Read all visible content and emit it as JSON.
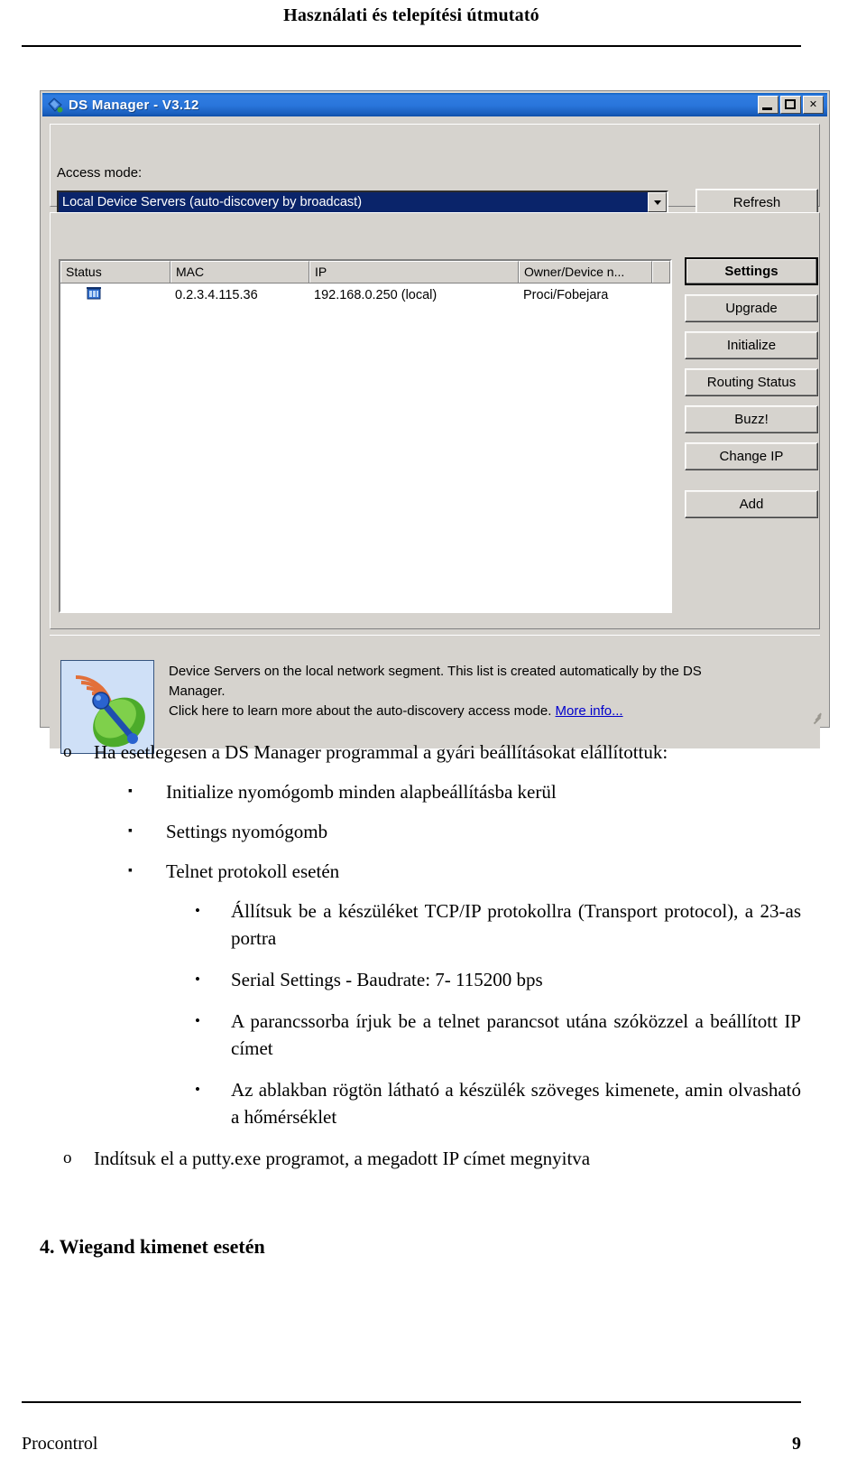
{
  "document": {
    "header_title": "Használati és telepítési útmutató",
    "footer_left": "Procontrol",
    "footer_page": "9",
    "section_heading": "4. Wiegand kimenet esetén"
  },
  "window": {
    "title": "DS Manager - V3.12",
    "icon": "ds-manager-icon",
    "controls": {
      "minimize": "_",
      "maximize": "□",
      "close": "✕"
    },
    "access": {
      "label": "Access mode:",
      "selected_option": "Local Device Servers (auto-discovery by broadcast)",
      "dropdown_icon": "chevron-down-icon",
      "refresh_label": "Refresh"
    },
    "list": {
      "columns": [
        "Status",
        "MAC",
        "IP",
        "Owner/Device n..."
      ],
      "rows": [
        {
          "status_icon": "device-status-icon",
          "mac": "0.2.3.4.115.36",
          "ip": "192.168.0.250 (local)",
          "owner": "Proci/Fobejara"
        }
      ]
    },
    "buttons": [
      {
        "label": "Settings",
        "default": true
      },
      {
        "label": "Upgrade",
        "default": false
      },
      {
        "label": "Initialize",
        "default": false
      },
      {
        "label": "Routing Status",
        "default": false
      },
      {
        "label": "Buzz!",
        "default": false
      },
      {
        "label": "Change IP",
        "default": false
      },
      {
        "label": "Add",
        "default": false
      }
    ],
    "info": {
      "icon": "satellite-dish-icon",
      "line1": "Device Servers on the local network segment. This list is created automatically by the DS",
      "line2": "Manager.",
      "line3": "Click here to learn more about the auto-discovery access mode.",
      "link": "More info..."
    }
  },
  "content": {
    "item1": "Ha esetlegesen a DS Manager programmal a gyári beállításokat elállítottuk:",
    "item1_marker": "o",
    "item2": "Initialize nyomógomb minden alapbeállításba kerül",
    "item3": "Settings nyomógomb",
    "item4": "Telnet protokoll esetén",
    "sub_marker": "▪",
    "item5": "Állítsuk be a készüléket TCP/IP protokollra (Transport protocol), a 23-as portra",
    "item6": "Serial Settings - Baudrate: 7- 115200 bps",
    "item7": "A parancssorba írjuk be a telnet parancsot utána szóközzel a beállított IP címet",
    "item8": "Az ablakban rögtön látható a készülék szöveges kimenete, amin olvasható a hőmérséklet",
    "bullet_marker": "•",
    "item9": "Indítsuk el a putty.exe programot, a megadott IP címet megnyitva",
    "item9_marker": "o"
  },
  "colors": {
    "titlebar_blue": "#2a76dc",
    "selection_blue": "#0a246a",
    "window_face": "#d6d3ce",
    "link_blue": "#0000cc"
  }
}
